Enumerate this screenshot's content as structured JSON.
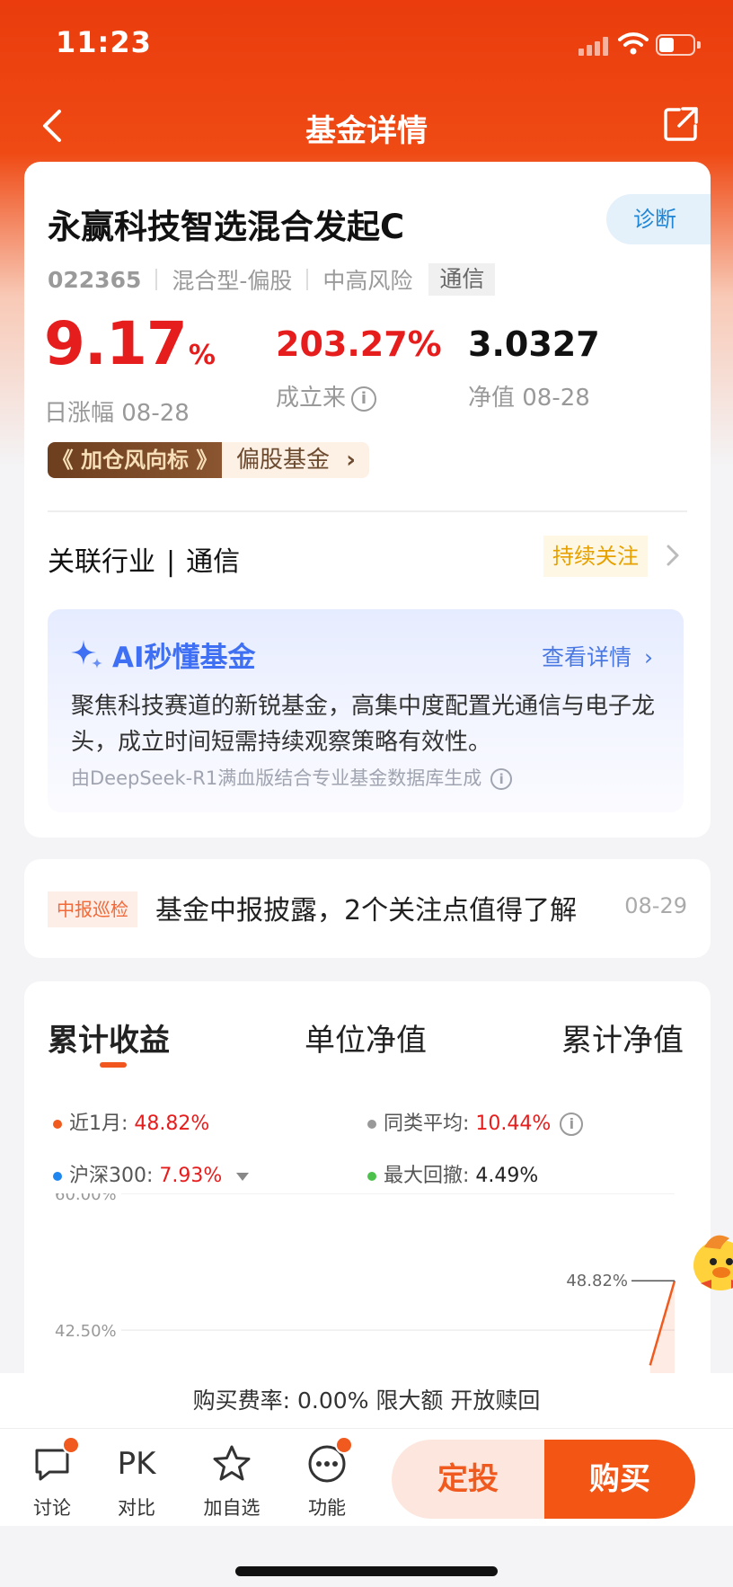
{
  "status_bar": {
    "time": "11:23"
  },
  "nav": {
    "title": "基金详情"
  },
  "fund": {
    "name": "永赢科技智选混合发起C",
    "diagnose_label": "诊断",
    "code": "022365",
    "type": "混合型-偏股",
    "risk": "中高风险",
    "tag": "通信",
    "daily_change_value": "9.17",
    "daily_change_unit": "%",
    "daily_change_label": "日涨幅 08-28",
    "since_inception_value": "203.27%",
    "since_inception_label": "成立来",
    "nav_value": "3.0327",
    "nav_label": "净值 08-28",
    "badge_left": "加仓风向标",
    "badge_right": "偏股基金",
    "industry_label": "关联行业",
    "industry_value": "通信",
    "follow_label": "持续关注"
  },
  "ai": {
    "title": "AI秒懂基金",
    "link": "查看详情",
    "body": "聚焦科技赛道的新锐基金，高集中度配置光通信与电子龙头，成立时间短需持续观察策略有效性。",
    "footer": "由DeepSeek-R1满血版结合专业基金数据库生成"
  },
  "news": {
    "tag": "中报巡检",
    "text": "基金中报披露，2个关注点值得了解",
    "date": "08-29"
  },
  "chart_tabs": [
    {
      "label": "累计收益"
    },
    {
      "label": "单位净值"
    },
    {
      "label": "累计净值"
    }
  ],
  "legend": {
    "month_label": "近1月:",
    "month_value": "48.82%",
    "peer_label": "同类平均:",
    "peer_value": "10.44%",
    "hs300_label": "沪深300:",
    "hs300_value": "7.93%",
    "drawdown_label": "最大回撤:",
    "drawdown_value": "4.49%"
  },
  "colors": {
    "brand": "#f05a1e",
    "rise": "#e61d1d",
    "fund_line": "#f05a1e",
    "peer_dot": "#999999",
    "hs300_dot": "#1f86f0",
    "drawdown_dot": "#4cc14c"
  },
  "chart_data": {
    "type": "line",
    "ytick_labels": [
      "60.00%",
      "42.50%"
    ],
    "y_ticks": [
      60.0,
      42.5
    ],
    "ylim": [
      37.0,
      60.0
    ],
    "series": [
      {
        "name": "近1月",
        "x": [
          0.955,
          1.0
        ],
        "values": [
          38.0,
          48.82
        ]
      }
    ],
    "annotation": "48.82%",
    "grid": true
  },
  "footer": {
    "fee_text": "购买费率: 0.00% 限大额 开放赎回",
    "items": [
      {
        "label": "讨论",
        "icon": "chat-icon"
      },
      {
        "label": "对比",
        "icon": "pk-icon",
        "glyph": "PK"
      },
      {
        "label": "加自选",
        "icon": "star-icon"
      },
      {
        "label": "功能",
        "icon": "more-icon"
      }
    ],
    "invest_label": "定投",
    "buy_label": "购买"
  }
}
